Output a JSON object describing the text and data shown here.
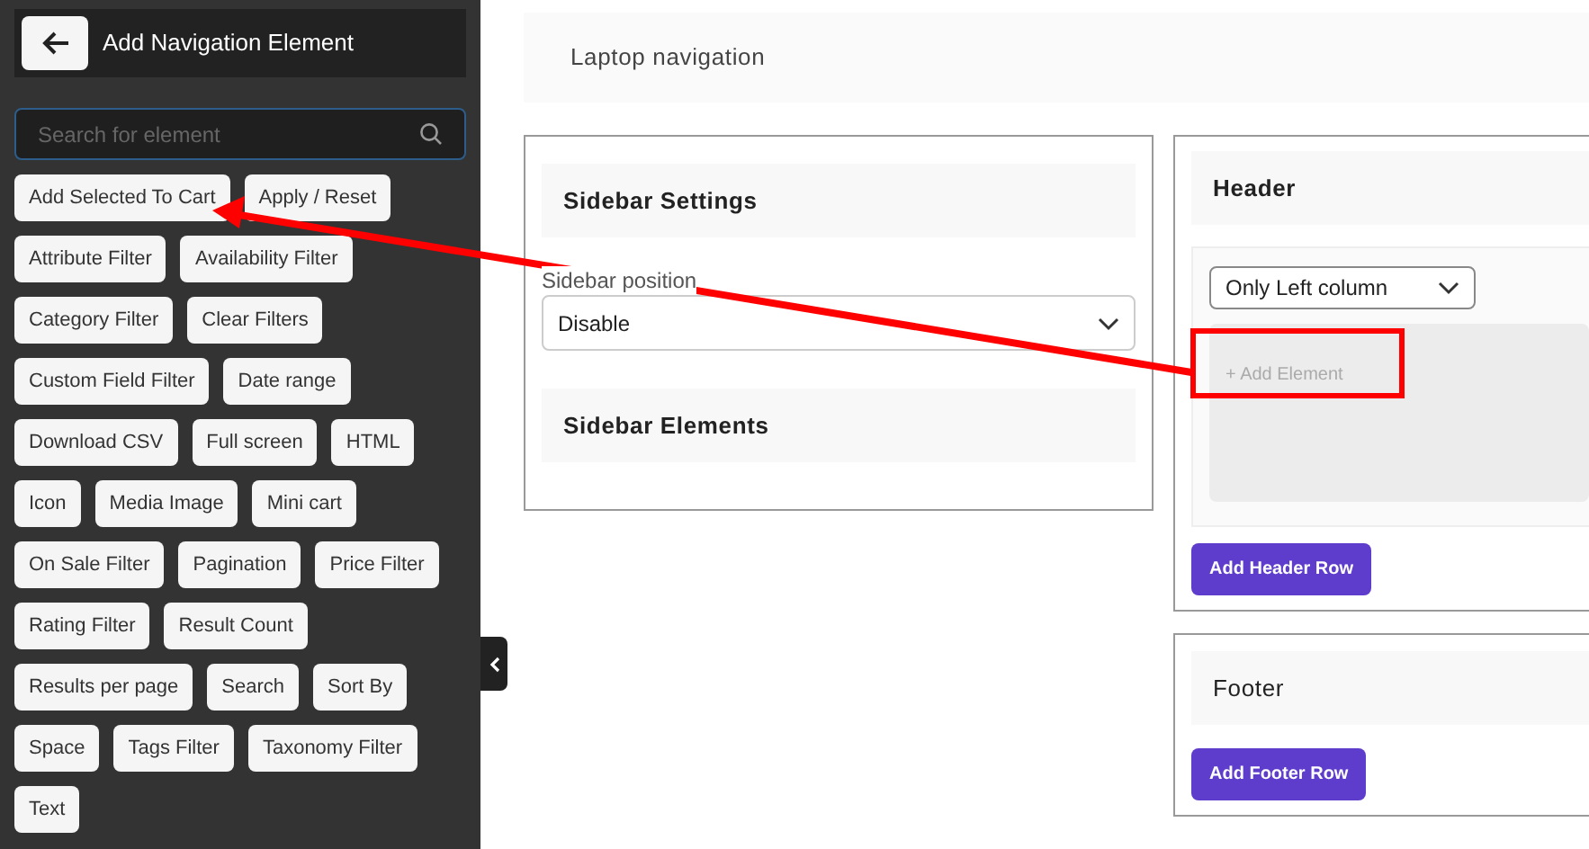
{
  "panel": {
    "title": "Add Navigation Element",
    "search": {
      "placeholder": "Search for element"
    },
    "elements": [
      "Add Selected To Cart",
      "Apply / Reset",
      "Attribute Filter",
      "Availability Filter",
      "Category Filter",
      "Clear Filters",
      "Custom Field Filter",
      "Date range",
      "Download CSV",
      "Full screen",
      "HTML",
      "Icon",
      "Media Image",
      "Mini cart",
      "On Sale Filter",
      "Pagination",
      "Price Filter",
      "Rating Filter",
      "Result Count",
      "Results per page",
      "Search",
      "Sort By",
      "Space",
      "Tags Filter",
      "Taxonomy Filter",
      "Text"
    ]
  },
  "main": {
    "title": "Laptop navigation",
    "sidebar": {
      "settings_title": "Sidebar Settings",
      "position_label": "Sidebar position",
      "position_value": "Disable",
      "elements_title": "Sidebar Elements"
    },
    "header": {
      "title": "Header",
      "layout_value": "Only Left column",
      "add_element": "+ Add Element",
      "add_row_button": "Add Header Row"
    },
    "footer": {
      "title": "Footer",
      "add_row_button": "Add Footer Row"
    }
  }
}
